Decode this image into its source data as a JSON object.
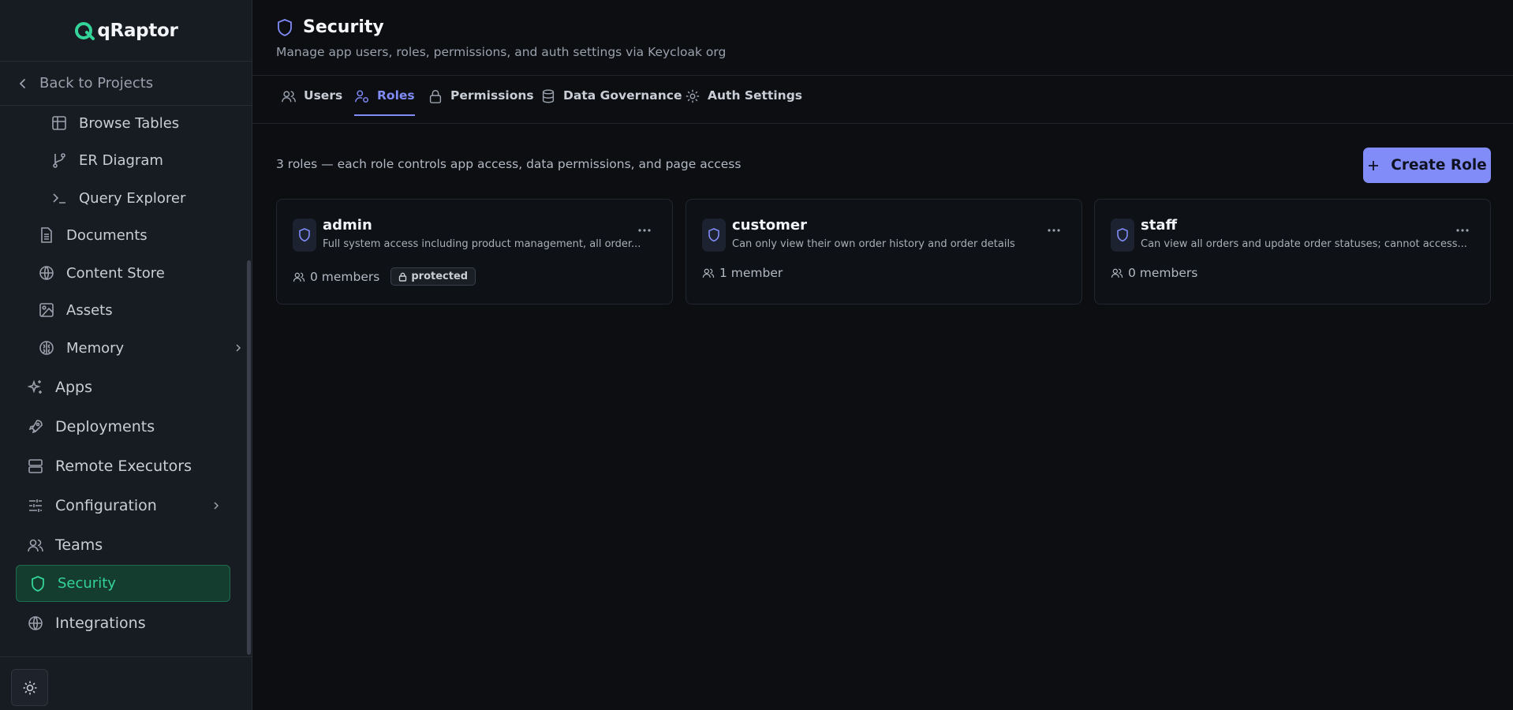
{
  "brand": {
    "logo_text": "qRaptor",
    "accent": "#34d399"
  },
  "sidebar": {
    "back_label": "Back to Projects",
    "items": [
      {
        "label": "Browse Tables",
        "icon": "table-icon"
      },
      {
        "label": "ER Diagram",
        "icon": "git-branch-icon"
      },
      {
        "label": "Query Explorer",
        "icon": "terminal-icon"
      },
      {
        "label": "Documents",
        "icon": "document-icon"
      },
      {
        "label": "Content Store",
        "icon": "globe-icon"
      },
      {
        "label": "Assets",
        "icon": "image-icon"
      },
      {
        "label": "Memory",
        "icon": "brain-icon"
      },
      {
        "label": "Apps",
        "icon": "sparkles-icon"
      },
      {
        "label": "Deployments",
        "icon": "rocket-icon"
      },
      {
        "label": "Remote Executors",
        "icon": "server-icon"
      },
      {
        "label": "Configuration",
        "icon": "sliders-icon"
      },
      {
        "label": "Teams",
        "icon": "users-icon"
      },
      {
        "label": "Security",
        "icon": "shield-icon",
        "active": true
      },
      {
        "label": "Integrations",
        "icon": "globe-icon"
      }
    ],
    "theme_toggle_icon": "sun-icon"
  },
  "header": {
    "title": "Security",
    "subtitle": "Manage app users, roles, permissions, and auth settings via Keycloak org"
  },
  "tabs": [
    {
      "label": "Users",
      "icon": "users-icon"
    },
    {
      "label": "Roles",
      "icon": "user-cog-icon",
      "active": true
    },
    {
      "label": "Permissions",
      "icon": "lock-icon"
    },
    {
      "label": "Data Governance",
      "icon": "database-icon"
    },
    {
      "label": "Auth Settings",
      "icon": "gear-icon"
    }
  ],
  "roles_view": {
    "summary": "3 roles — each role controls app access, data permissions, and page access",
    "create_button": "Create Role",
    "accent": "#818cf8",
    "roles": [
      {
        "name": "admin",
        "description": "Full system access including product management, all order...",
        "members": "0 members",
        "badge": "protected"
      },
      {
        "name": "customer",
        "description": "Can only view their own order history and order details",
        "members": "1 member",
        "badge": ""
      },
      {
        "name": "staff",
        "description": "Can view all orders and update order statuses; cannot access...",
        "members": "0 members",
        "badge": ""
      }
    ]
  }
}
